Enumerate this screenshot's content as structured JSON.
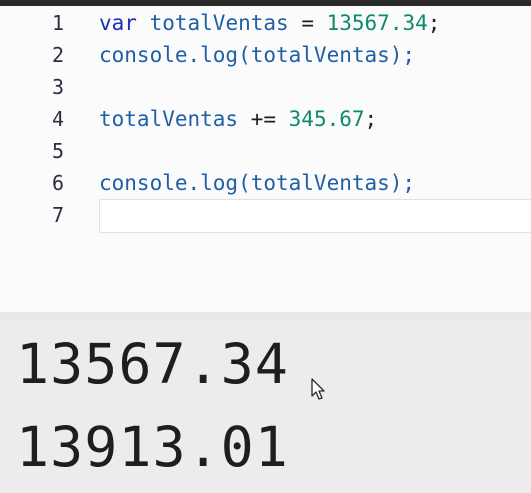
{
  "editor": {
    "lines": [
      {
        "number": "1",
        "parts": [
          {
            "type": "kw",
            "text": "var"
          },
          {
            "type": "plain",
            "text": " "
          },
          {
            "type": "ident",
            "text": "totalVentas"
          },
          {
            "type": "plain",
            "text": " = "
          },
          {
            "type": "num",
            "text": "13567.34"
          },
          {
            "type": "punct",
            "text": ";"
          }
        ]
      },
      {
        "number": "2",
        "parts": [
          {
            "type": "ident",
            "text": "console.log(totalVentas);"
          }
        ]
      },
      {
        "number": "3",
        "parts": []
      },
      {
        "number": "4",
        "parts": [
          {
            "type": "ident",
            "text": "totalVentas"
          },
          {
            "type": "plain",
            "text": " += "
          },
          {
            "type": "num",
            "text": "345.67"
          },
          {
            "type": "punct",
            "text": ";"
          }
        ]
      },
      {
        "number": "5",
        "parts": []
      },
      {
        "number": "6",
        "parts": [
          {
            "type": "ident",
            "text": "console.log(totalVentas);"
          }
        ]
      },
      {
        "number": "7",
        "parts": []
      }
    ]
  },
  "output": {
    "lines": [
      "13567.34",
      "13913.01"
    ]
  },
  "cursor_icon": "mouse-pointer-icon"
}
